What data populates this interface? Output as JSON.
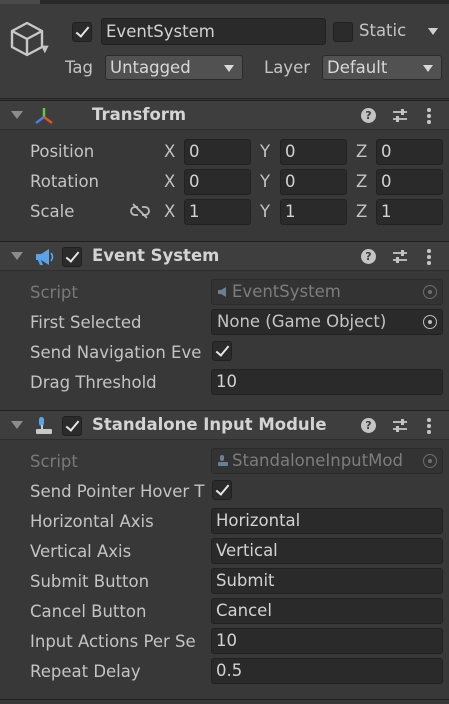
{
  "header": {
    "name_value": "EventSystem",
    "static_label": "Static",
    "tag_label": "Tag",
    "tag_value": "Untagged",
    "layer_label": "Layer",
    "layer_value": "Default",
    "active": true,
    "is_static": false
  },
  "transform": {
    "title": "Transform",
    "rows": [
      {
        "label": "Position",
        "x": "0",
        "y": "0",
        "z": "0"
      },
      {
        "label": "Rotation",
        "x": "0",
        "y": "0",
        "z": "0"
      },
      {
        "label": "Scale",
        "x": "1",
        "y": "1",
        "z": "1"
      }
    ],
    "axis": {
      "x": "X",
      "y": "Y",
      "z": "Z"
    }
  },
  "event_system": {
    "title": "Event System",
    "enabled": true,
    "script_label": "Script",
    "script_value": "EventSystem",
    "first_selected_label": "First Selected",
    "first_selected_value": "None (Game Object)",
    "send_nav_label": "Send Navigation Eve",
    "send_nav_checked": true,
    "drag_label": "Drag Threshold",
    "drag_value": "10"
  },
  "standalone": {
    "title": "Standalone Input Module",
    "enabled": true,
    "script_label": "Script",
    "script_value": "StandaloneInputMod",
    "send_pointer_label": "Send Pointer Hover T",
    "send_pointer_checked": true,
    "rows": [
      {
        "label": "Horizontal Axis",
        "value": "Horizontal"
      },
      {
        "label": "Vertical Axis",
        "value": "Vertical"
      },
      {
        "label": "Submit Button",
        "value": "Submit"
      },
      {
        "label": "Cancel Button",
        "value": "Cancel"
      },
      {
        "label": "Input Actions Per Se",
        "value": "10"
      },
      {
        "label": "Repeat Delay",
        "value": "0.5"
      }
    ]
  },
  "icons": {
    "gameobject": "cube-icon",
    "transform": "transform-axes-icon",
    "event_system": "megaphone-icon",
    "standalone": "input-module-icon",
    "help": "help-icon",
    "presets": "presets-icon",
    "menu": "kebab-menu-icon",
    "link": "unlinked-scale-icon",
    "picker": "object-picker-icon"
  },
  "colors": {
    "background": "#383838",
    "field": "#2a2a2a",
    "header": "#3e3e3e",
    "text": "#c4c4c4",
    "disabled_text": "#797979"
  }
}
